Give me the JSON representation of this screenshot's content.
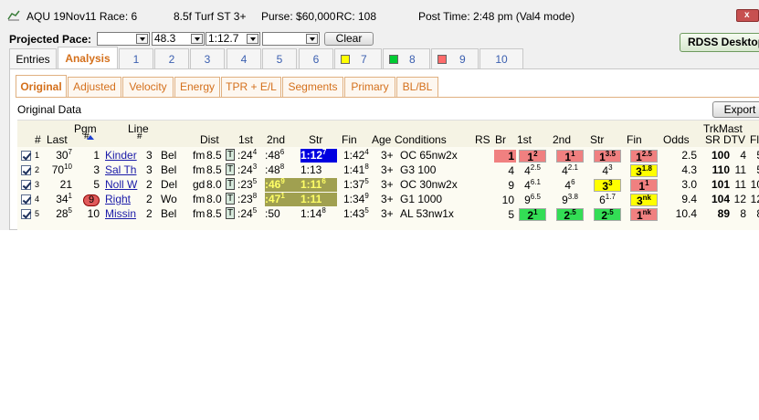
{
  "title": {
    "track_date_race": "AQU 19Nov11 Race: 6",
    "dist_surface": "8.5f  Turf  ST  3+",
    "purse": "Purse: $60,000",
    "rc": "RC: 108",
    "post_time": "Post Time: 2:48 pm  (Val4 mode)",
    "close_glyph": "x"
  },
  "pace": {
    "label": "Projected Pace:",
    "combo1": "",
    "combo2": "48.3",
    "combo3": "1:12.7",
    "combo4": "",
    "clear": "Clear",
    "rdss": "RDSS Desktop"
  },
  "top_tabs": [
    {
      "label": "Entries"
    },
    {
      "label": "Analysis"
    },
    {
      "label": "1"
    },
    {
      "label": "2"
    },
    {
      "label": "3"
    },
    {
      "label": "4"
    },
    {
      "label": "5"
    },
    {
      "label": "6"
    },
    {
      "label": "7"
    },
    {
      "label": "8"
    },
    {
      "label": "9"
    },
    {
      "label": "10"
    }
  ],
  "swatch_colors": {
    "tab7": "#ffff00",
    "tab8": "#00cc33",
    "tab9": "#ff6b6b"
  },
  "sub_tabs": [
    {
      "label": "Original"
    },
    {
      "label": "Adjusted"
    },
    {
      "label": "Velocity"
    },
    {
      "label": "Energy"
    },
    {
      "label": "TPR + E/L"
    },
    {
      "label": "Segments"
    },
    {
      "label": "Primary"
    },
    {
      "label": "BL/BL"
    }
  ],
  "section_label": "Original Data",
  "export": "Export",
  "headers": {
    "num": "#",
    "last": "Last",
    "pgm": "Pgm",
    "pgm2": "#",
    "line": "Line",
    "line2": "#",
    "dist": "Dist",
    "c1st": "1st",
    "c2nd": "2nd",
    "str": "Str",
    "fin": "Fin",
    "age": "Age",
    "conditions": "Conditions",
    "rs": "RS",
    "br": "Br",
    "b1st": "1st",
    "b2nd": "2nd",
    "bstr": "Str",
    "bfin": "Fin",
    "odds": "Odds",
    "trkmast": "TrkMast",
    "sr": "SR",
    "dtv": "DTV",
    "fld": "Fld"
  },
  "colors": {
    "red": "#f08080",
    "green": "#33dd55",
    "yellow": "#ffff00",
    "olive": "#a0a050",
    "blue_hl": "#0000e0"
  },
  "rows": [
    {
      "n": "1",
      "last": "30",
      "last_sup": "7",
      "pgm": "1",
      "name": "Kinder",
      "line": "3",
      "trk": "Bel",
      "cond": "fm",
      "dist": "8.5",
      "t": "T",
      "f1": ":24",
      "f1s": "4",
      "f2": ":48",
      "f2s": "6",
      "str": "1:12",
      "strs": "7",
      "fin": "1:42",
      "fins": "4",
      "age": "3+",
      "conds": "OC 65nw2x",
      "rs": "",
      "br": "1",
      "b1": "1",
      "b1s": "2",
      "b2": "1",
      "b2s": "1",
      "bs": "1",
      "bss": "3.5",
      "bf": "1",
      "bfs": "2.5",
      "odds": "2.5",
      "sr": "100",
      "dtv": "4",
      "fld": "5"
    },
    {
      "n": "2",
      "last": "70",
      "last_sup": "10",
      "pgm": "3",
      "name": "Sal Th",
      "line": "3",
      "trk": "Bel",
      "cond": "fm",
      "dist": "8.5",
      "t": "T",
      "f1": ":24",
      "f1s": "3",
      "f2": ":48",
      "f2s": "8",
      "str": "1:13",
      "strs": "",
      "fin": "1:41",
      "fins": "8",
      "age": "3+",
      "conds": "G3 100",
      "rs": "",
      "br": "4",
      "b1": "4",
      "b1s": "2.5",
      "b2": "4",
      "b2s": "2.1",
      "bs": "4",
      "bss": "3",
      "bf": "3",
      "bfs": "1.8",
      "odds": "4.3",
      "sr": "110",
      "dtv": "11",
      "fld": "5"
    },
    {
      "n": "3",
      "last": "21",
      "last_sup": "",
      "pgm": "5",
      "name": "Noll W",
      "line": "2",
      "trk": "Del",
      "cond": "gd",
      "dist": "8.0",
      "t": "T",
      "f1": ":23",
      "f1s": "5",
      "f2": ":46",
      "f2s": "9",
      "str": "1:11",
      "strs": "6",
      "fin": "1:37",
      "fins": "5",
      "age": "3+",
      "conds": "OC 30nw2x",
      "rs": "",
      "br": "9",
      "b1": "4",
      "b1s": "6.1",
      "b2": "4",
      "b2s": "6",
      "bs": "3",
      "bss": "3",
      "bf": "1",
      "bfs": "1",
      "odds": "3.0",
      "sr": "101",
      "dtv": "11",
      "fld": "10"
    },
    {
      "n": "4",
      "last": "34",
      "last_sup": "1",
      "pgm": "9",
      "name": "Right",
      "line": "2",
      "trk": "Wo",
      "cond": "fm",
      "dist": "8.0",
      "t": "T",
      "f1": ":23",
      "f1s": "8",
      "f2": ":47",
      "f2s": "1",
      "str": "1:11",
      "strs": "",
      "fin": "1:34",
      "fins": "9",
      "age": "3+",
      "conds": "G1 1000",
      "rs": "",
      "br": "10",
      "b1": "9",
      "b1s": "6.5",
      "b2": "9",
      "b2s": "3.8",
      "bs": "6",
      "bss": "1.7",
      "bf": "3",
      "bfs": "nk",
      "odds": "9.4",
      "sr": "104",
      "dtv": "12",
      "fld": "12"
    },
    {
      "n": "5",
      "last": "28",
      "last_sup": "5",
      "pgm": "10",
      "name": "Missin",
      "line": "2",
      "trk": "Bel",
      "cond": "fm",
      "dist": "8.5",
      "t": "T",
      "f1": ":24",
      "f1s": "5",
      "f2": ":50",
      "f2s": "",
      "str": "1:14",
      "strs": "8",
      "fin": "1:43",
      "fins": "5",
      "age": "3+",
      "conds": "AL 53nw1x",
      "rs": "",
      "br": "5",
      "b1": "2",
      "b1s": "1",
      "b2": "2",
      "b2s": ".5",
      "bs": "2",
      "bss": ".5",
      "bf": "1",
      "bfs": "nk",
      "odds": "10.4",
      "sr": "89",
      "dtv": "8",
      "fld": "8"
    }
  ]
}
